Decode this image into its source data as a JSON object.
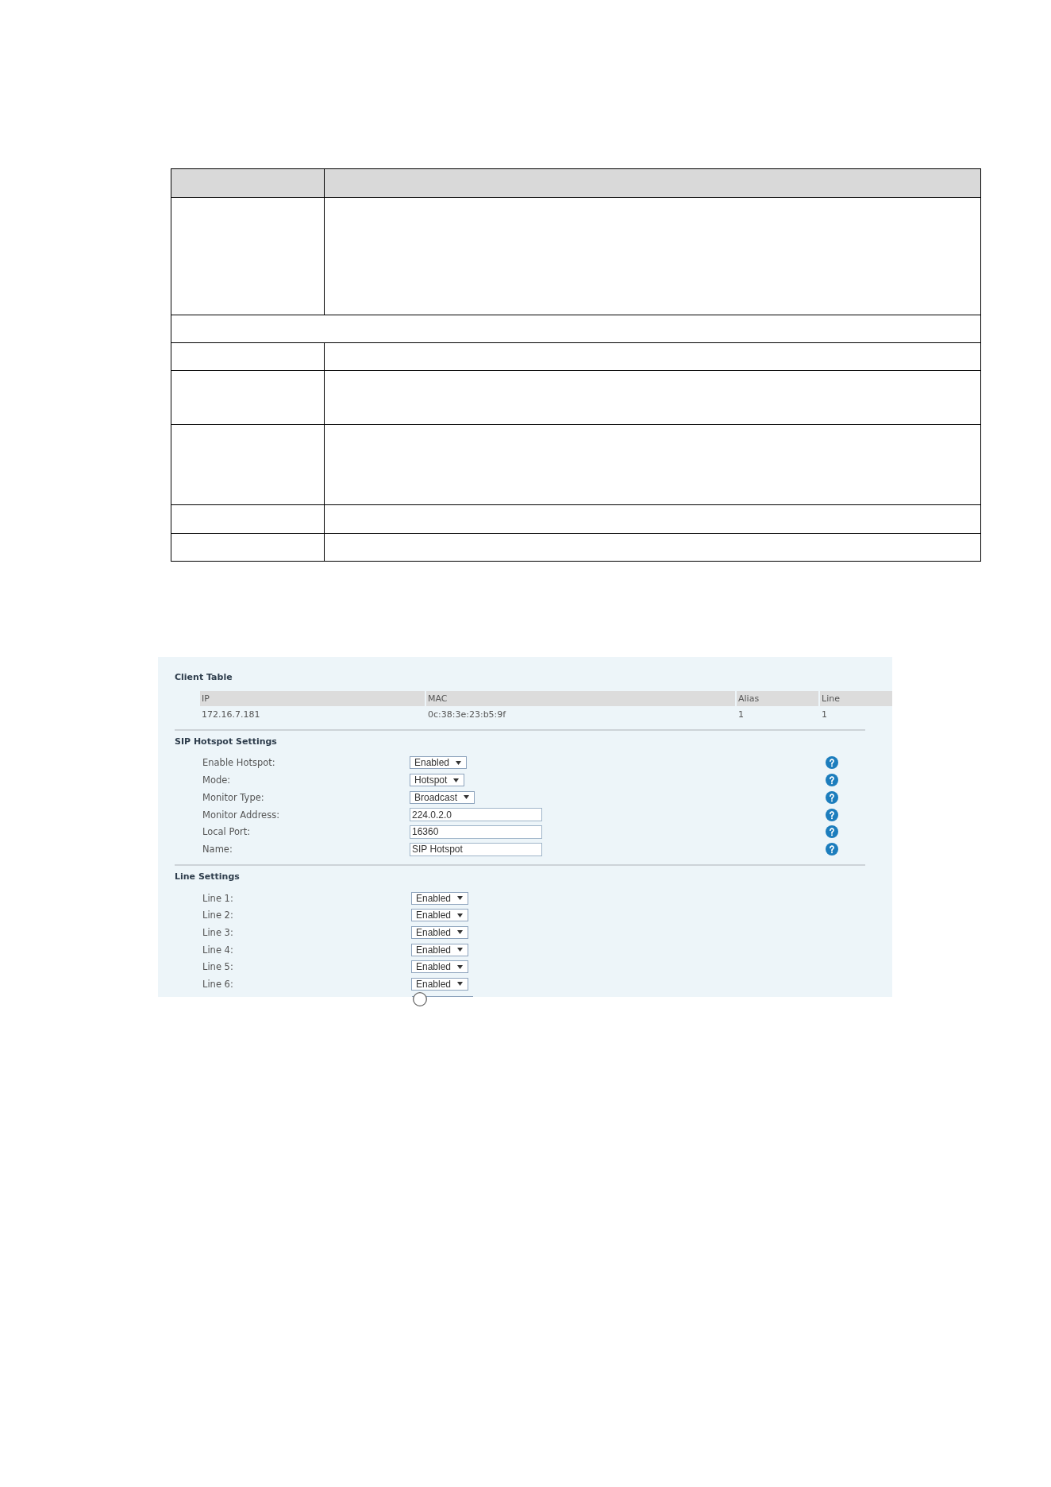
{
  "doc_table": {
    "rows": [
      {
        "kind": "header"
      },
      {
        "kind": "split"
      },
      {
        "kind": "merged"
      },
      {
        "kind": "split"
      },
      {
        "kind": "split"
      },
      {
        "kind": "split"
      },
      {
        "kind": "split"
      },
      {
        "kind": "split"
      }
    ]
  },
  "settings_page": {
    "client_table": {
      "title": "Client Table",
      "columns": [
        "IP",
        "MAC",
        "Alias",
        "Line"
      ],
      "rows": [
        [
          "172.16.7.181",
          "0c:38:3e:23:b5:9f",
          "1",
          "1"
        ]
      ]
    },
    "hotspot_settings": {
      "title": "SIP Hotspot Settings",
      "fields": [
        {
          "label": "Enable Hotspot:",
          "kind": "select",
          "value": "Enabled",
          "help": true
        },
        {
          "label": "Mode:",
          "kind": "select",
          "value": "Hotspot",
          "help": true
        },
        {
          "label": "Monitor Type:",
          "kind": "select",
          "value": "Broadcast",
          "help": true
        },
        {
          "label": "Monitor Address:",
          "kind": "input",
          "value": "224.0.2.0",
          "help": true
        },
        {
          "label": "Local Port:",
          "kind": "input",
          "value": "16360",
          "help": true
        },
        {
          "label": "Name:",
          "kind": "input",
          "value": "SIP Hotspot",
          "help": true
        }
      ]
    },
    "line_settings": {
      "title": "Line Settings",
      "fields": [
        {
          "label": "Line 1:",
          "kind": "select",
          "value": "Enabled"
        },
        {
          "label": "Line 2:",
          "kind": "select",
          "value": "Enabled"
        },
        {
          "label": "Line 3:",
          "kind": "select",
          "value": "Enabled"
        },
        {
          "label": "Line 4:",
          "kind": "select",
          "value": "Enabled"
        },
        {
          "label": "Line 5:",
          "kind": "select",
          "value": "Enabled"
        },
        {
          "label": "Line 6:",
          "kind": "select",
          "value": "Enabled"
        }
      ]
    }
  }
}
